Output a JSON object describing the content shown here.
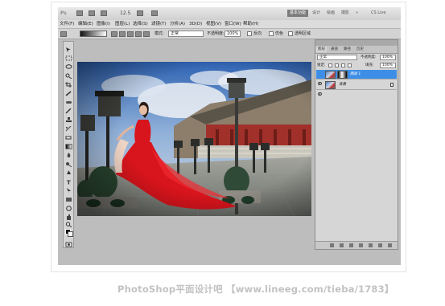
{
  "app": {
    "logo": "Ps",
    "zoom": "12.5",
    "workspace_buttons": [
      "基本功能",
      "设计",
      "绘画",
      "摄影"
    ],
    "cs_live": "CS Live"
  },
  "menu": [
    "文件(F)",
    "编辑(E)",
    "图像(I)",
    "图层(L)",
    "选择(S)",
    "滤镜(T)",
    "分析(A)",
    "3D(D)",
    "视图(V)",
    "窗口(W)",
    "帮助(H)"
  ],
  "options": {
    "mode_label": "模式:",
    "mode_value": "正常",
    "opacity_label": "不透明度:",
    "opacity_value": "100%",
    "reverse_label": "反向",
    "dither_label": "仿色",
    "transparency_label": "透明区域"
  },
  "layers_panel": {
    "tabs": [
      "图层",
      "通道",
      "路径",
      "历史"
    ],
    "blend_mode": "正常",
    "opacity_label": "不透明度:",
    "opacity_value": "100%",
    "lock_label": "锁定:",
    "fill_label": "填充:",
    "fill_value": "100%",
    "layers": [
      {
        "name": "图层 1",
        "selected": true
      },
      {
        "name": "背景",
        "selected": false
      }
    ]
  },
  "colors": {
    "selected_layer": "#3d8ee6",
    "dress_red": "#d8141c"
  },
  "caption": "PhotoShop平面设计吧 【www.lineeg.com/tieba/1783】"
}
